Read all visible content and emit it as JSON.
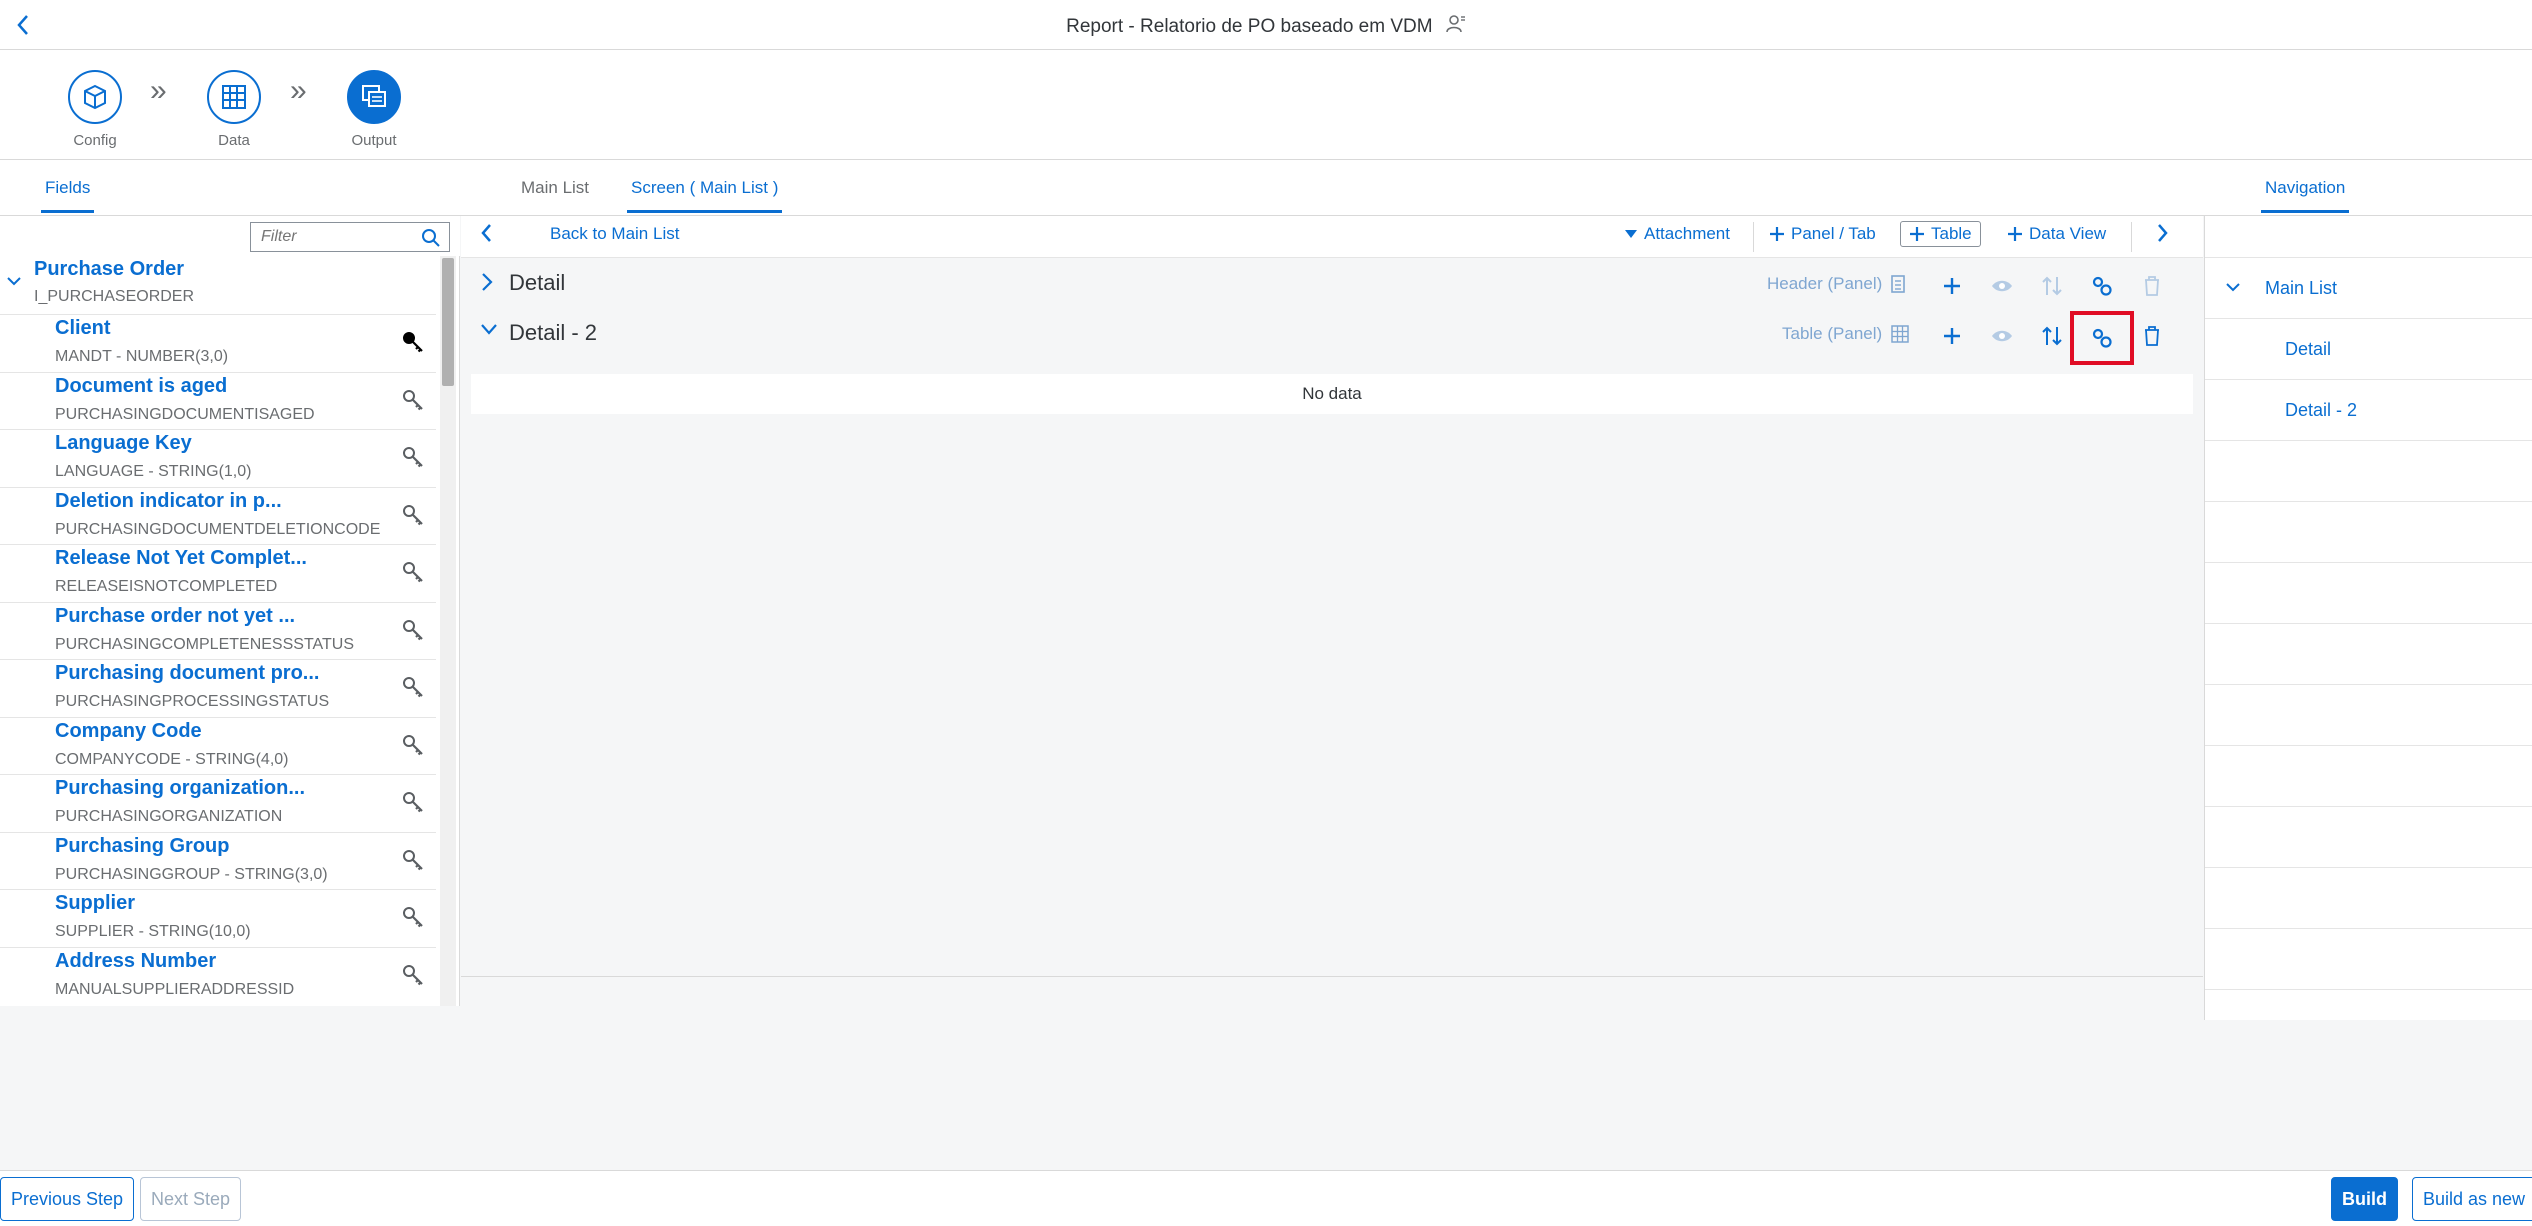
{
  "shell": {
    "title": "Report - Relatorio de PO baseado em VDM"
  },
  "wizard": {
    "steps": [
      {
        "label": "Config",
        "icon": "cube-icon"
      },
      {
        "label": "Data",
        "icon": "grid-icon"
      },
      {
        "label": "Output",
        "icon": "output-icon",
        "active": true
      }
    ]
  },
  "tabs": {
    "left": "Fields",
    "center": [
      "Main List",
      "Screen ( Main List )"
    ],
    "right": "Navigation"
  },
  "filter": {
    "placeholder": "Filter"
  },
  "tree": {
    "root": {
      "name": "Purchase Order",
      "sub": "I_PURCHASEORDER"
    },
    "fields": [
      {
        "name": "Client",
        "sub": "MANDT - NUMBER(3,0)",
        "key": true
      },
      {
        "name": "Document is aged",
        "sub": "PURCHASINGDOCUMENTISAGED"
      },
      {
        "name": "Language Key",
        "sub": "LANGUAGE - STRING(1,0)"
      },
      {
        "name": "Deletion indicator in p...",
        "sub": "PURCHASINGDOCUMENTDELETIONCODE"
      },
      {
        "name": "Release Not Yet Complet...",
        "sub": "RELEASEISNOTCOMPLETED"
      },
      {
        "name": "Purchase order not yet ...",
        "sub": "PURCHASINGCOMPLETENESSSTATUS"
      },
      {
        "name": "Purchasing document pro...",
        "sub": "PURCHASINGPROCESSINGSTATUS"
      },
      {
        "name": "Company Code",
        "sub": "COMPANYCODE - STRING(4,0)"
      },
      {
        "name": "Purchasing organization...",
        "sub": "PURCHASINGORGANIZATION"
      },
      {
        "name": "Purchasing Group",
        "sub": "PURCHASINGGROUP - STRING(3,0)"
      },
      {
        "name": "Supplier",
        "sub": "SUPPLIER - STRING(10,0)"
      },
      {
        "name": "Address Number",
        "sub": "MANUALSUPPLIERADDRESSID"
      }
    ]
  },
  "toolbar": {
    "back_label": "Back to Main List",
    "attachment": "Attachment",
    "panel_tab": "Panel / Tab",
    "table": "Table",
    "data_view": "Data View"
  },
  "sections": [
    {
      "title": "Detail",
      "type": "Header (Panel)",
      "expanded": false
    },
    {
      "title": "Detail - 2",
      "type": "Table (Panel)",
      "expanded": true
    }
  ],
  "no_data": "No data",
  "navigation": {
    "items": [
      "Main List",
      "Detail",
      "Detail - 2"
    ]
  },
  "footer": {
    "previous": "Previous Step",
    "next": "Next Step",
    "build": "Build",
    "build_new": "Build as new"
  },
  "colors": {
    "accent": "#0a6ed1",
    "highlight": "#e00d25",
    "muted_blue": "#7fa6d1"
  }
}
